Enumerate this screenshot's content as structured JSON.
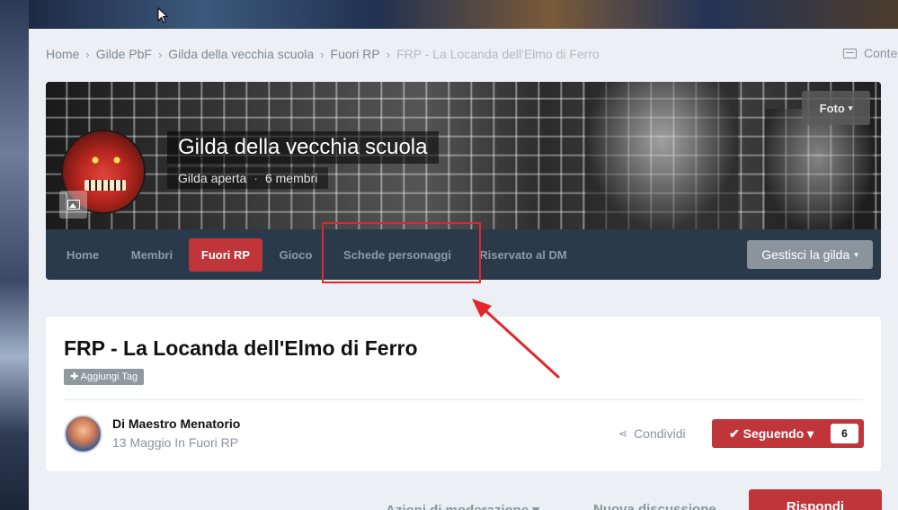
{
  "breadcrumb": {
    "items": [
      "Home",
      "Gilde PbF",
      "Gilda della vecchia scuola",
      "Fuori RP"
    ],
    "current": "FRP - La Locanda dell'Elmo di Ferro",
    "separator": "›"
  },
  "content_link": {
    "label": "Conte",
    "icon": "content-icon"
  },
  "guild": {
    "title": "Gilda della vecchia scuola",
    "status": "Gilda aperta",
    "dot": "·",
    "members": "6 membri",
    "photo_button": "Foto",
    "caret": "▾",
    "nav": [
      "Home",
      "Membri",
      "Fuori RP",
      "Gioco",
      "Schede personaggi",
      "Riservato al DM"
    ],
    "active_nav": "Fuori RP",
    "manage_button": "Gestisci la gilda"
  },
  "topic": {
    "title": "FRP - La Locanda dell'Elmo di Ferro",
    "add_tag": "✚ Aggiungi Tag",
    "author": "Di Maestro Menatorio",
    "meta": "13 Maggio In Fuori RP",
    "share": "Condividi",
    "share_icon": "⋖",
    "follow_label": "✔ Seguendo ▾",
    "follow_count": "6"
  },
  "toolbar": {
    "moderation": "Azioni di moderazione ▾",
    "new_discussion": "Nuova discussione",
    "reply": "Rispondi"
  },
  "colors": {
    "accent": "#c0353a",
    "nav_bg": "#2a3a4b",
    "annotation": "#e3262b"
  }
}
